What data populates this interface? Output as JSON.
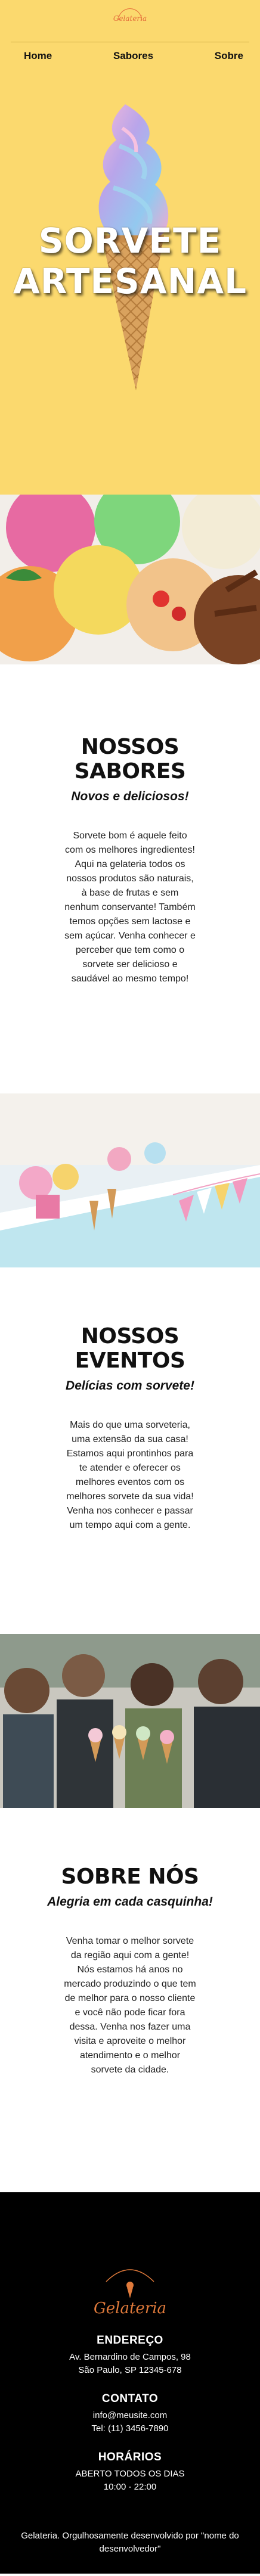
{
  "brand": {
    "logo_text": "Gelateria"
  },
  "nav": {
    "items": [
      "Home",
      "Sabores",
      "Sobre"
    ]
  },
  "hero": {
    "title_line1": "SORVETE",
    "title_line2": "ARTESANAL"
  },
  "flavors": {
    "title": "NOSSOS SABORES",
    "subtitle": "Novos e deliciosos!",
    "body": "Sorvete bom é aquele feito com os melhores ingredientes! Aqui na gelateria todos os nossos produtos são naturais, à base de frutas e sem nenhum conservante! Também temos opções sem lactose e sem açúcar. Venha conhecer e perceber que tem como o sorvete ser delicioso e saudável ao mesmo tempo!"
  },
  "events": {
    "title": "NOSSOS EVENTOS",
    "subtitle": "Delícias com sorvete!",
    "body": "Mais do que uma sorveteria, uma extensão da sua casa! Estamos aqui prontinhos para te atender e oferecer os melhores eventos com os melhores sorvete da sua vida! Venha nos conhecer e passar um tempo aqui com a gente."
  },
  "about": {
    "title": "SOBRE NÓS",
    "subtitle": "Alegria em cada casquinha!",
    "body": "Venha tomar o melhor sorvete da região aqui com a gente! Nós estamos há anos no mercado produzindo o que tem de melhor para o nosso cliente e você não pode ficar fora dessa. Venha nos fazer uma visita e aproveite o melhor atendimento e o melhor sorvete da cidade."
  },
  "footer": {
    "logo_text": "Gelateria",
    "address_title": "ENDEREÇO",
    "address_line1": "Av. Bernardino de Campos, 98",
    "address_line2": "São Paulo, SP 12345-678",
    "contact_title": "CONTATO",
    "email": "info@meusite.com",
    "phone": "Tel: (11) 3456-7890",
    "hours_title": "HORÁRIOS",
    "hours_line1": "ABERTO TODOS OS DIAS",
    "hours_line2": "10:00 - 22:00",
    "credit": "Gelateria. Orgulhosamente desenvolvido por \"nome do desenvolvedor\""
  },
  "colors": {
    "hero_bg": "#fbd96e",
    "accent": "#e46c3a",
    "footer_bg": "#000000"
  }
}
